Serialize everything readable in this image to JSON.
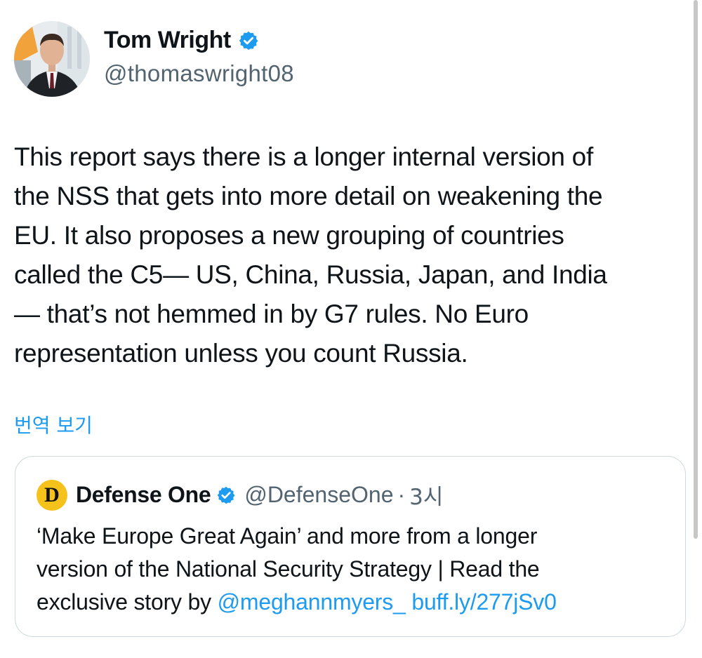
{
  "author": {
    "display_name": "Tom Wright",
    "handle": "@thomaswright08",
    "avatar_icon": "profile-photo",
    "verified_icon": "verified-badge-icon"
  },
  "tweet": {
    "text": "This report says there is a longer internal version of\nthe NSS that gets into more detail on weakening the\nEU. It also proposes a new grouping of countries\ncalled the C5— US, China, Russia, Japan, and India\n— that’s not hemmed in by G7 rules. No Euro\nrepresentation unless you count Russia.",
    "translate_label": "번역 보기"
  },
  "quote": {
    "logo_letter": "D",
    "display_name": "Defense One",
    "handle": "@DefenseOne",
    "separator": "·",
    "time": "3시",
    "text_line1": "‘Make Europe Great Again’ and more from a longer",
    "text_line2": "version of the National Security Strategy |  Read the",
    "text_line3_prefix": "exclusive story by ",
    "mention": "@meghannmyers_",
    "link": "buff.ly/277jSv0"
  },
  "colors": {
    "accent": "#1d9bf0",
    "text": "#0f1419",
    "secondary": "#536471",
    "border": "#cfd9de",
    "logo_bg": "#f4c21b"
  }
}
